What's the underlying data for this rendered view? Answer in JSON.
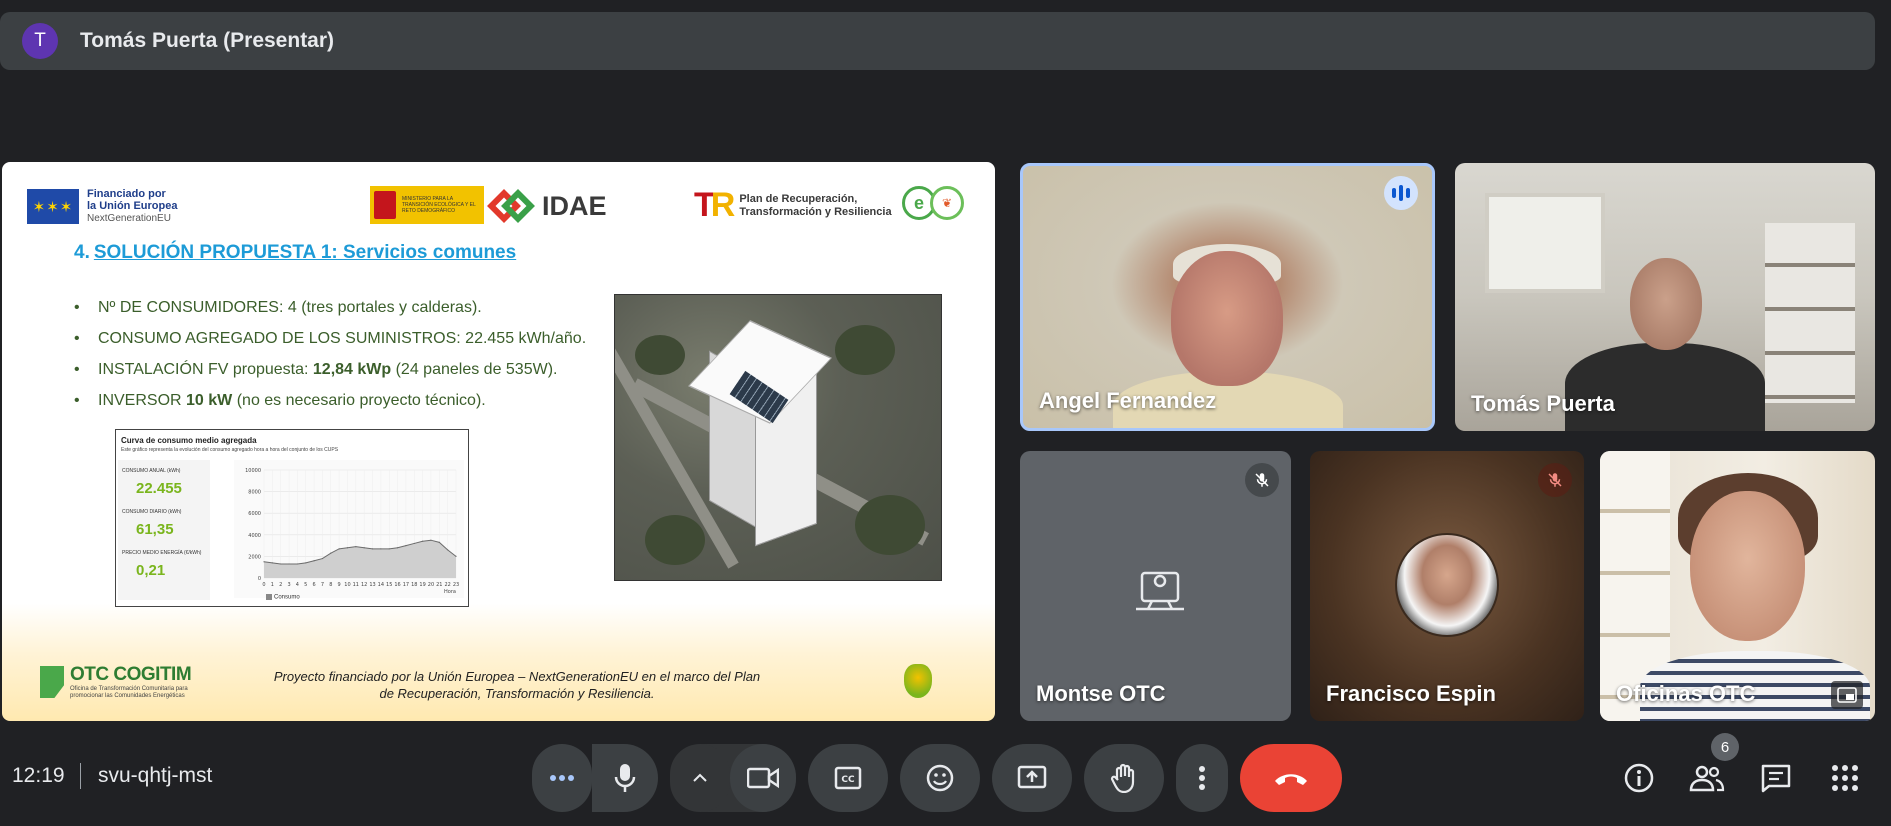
{
  "presenter_bar": {
    "avatar_letter": "T",
    "title": "Tomás Puerta (Presentar)"
  },
  "slide": {
    "logos": {
      "eu_line1": "Financiado por",
      "eu_line2": "la Unión Europea",
      "eu_line3": "NextGenerationEU",
      "ministerio_text": "MINISTERIO PARA LA TRANSICIÓN ECOLÓGICA Y EL RETO DEMOGRÁFICO",
      "idae": "IDAE",
      "plan_line1": "Plan de Recuperación,",
      "plan_line2": "Transformación y Resiliencia",
      "eco_mark": "e"
    },
    "title_number": "4.",
    "title_text": "SOLUCIÓN PROPUESTA 1: Servicios comunes",
    "bullets": [
      {
        "text": "Nº DE CONSUMIDORES: 4 (tres portales y calderas).",
        "bold": "",
        "rest": ""
      },
      {
        "text": "CONSUMO AGREGADO DE LOS SUMINISTROS: 22.455 kWh/año.",
        "bold": "",
        "rest": ""
      },
      {
        "text": "INSTALACIÓN FV propuesta: ",
        "bold": "12,84 kWp",
        "rest": " (24 paneles de 535W)."
      },
      {
        "text": "INVERSOR ",
        "bold": "10 kW",
        "rest": " (no es necesario proyecto técnico)."
      }
    ],
    "chart": {
      "title": "Curva de consumo medio agregada",
      "description": "Este gráfico representa la evolución del consumo agregado hora a hora del conjunto de los CUPS",
      "kpis": [
        {
          "label": "CONSUMO ANUAL (kWh)",
          "value": "22.455"
        },
        {
          "label": "CONSUMO DIARIO (kWh)",
          "value": "61,35"
        },
        {
          "label": "PRECIO MEDIO ENERGÍA (€/kWh)",
          "value": "0,21"
        }
      ],
      "legend": "Consumo",
      "x_label": "Hora"
    },
    "footer": {
      "org_name": "OTC COGITIM",
      "org_sub": "Oficina de Transformación Comunitaria para promocionar las Comunidades Energéticas",
      "text_line1": "Proyecto financiado por la Unión Europea – NextGenerationEU en el marco del Plan",
      "text_line2": "de Recuperación, Transformación y Resiliencia."
    }
  },
  "chart_data": {
    "type": "area",
    "title": "Curva de consumo medio agregada",
    "xlabel": "Hora",
    "ylabel": "",
    "x": [
      0,
      1,
      2,
      3,
      4,
      5,
      6,
      7,
      8,
      9,
      10,
      11,
      12,
      13,
      14,
      15,
      16,
      17,
      18,
      19,
      20,
      21,
      22,
      23
    ],
    "series": [
      {
        "name": "Consumo",
        "values": [
          1500,
          1400,
          1300,
          1300,
          1300,
          1400,
          1600,
          1800,
          2300,
          2700,
          2800,
          2900,
          2800,
          2700,
          2700,
          2700,
          2800,
          3000,
          3200,
          3400,
          3500,
          3300,
          2600,
          2000
        ]
      }
    ],
    "ylim": [
      0,
      10000
    ],
    "yticks": [
      0,
      2000,
      4000,
      6000,
      8000,
      10000
    ]
  },
  "participants": [
    {
      "name": "Angel Fernandez",
      "speaking": true,
      "muted": false
    },
    {
      "name": "Tomás Puerta",
      "speaking": false,
      "muted": false
    },
    {
      "name": "Montse OTC",
      "speaking": false,
      "muted": true,
      "camera_off": true
    },
    {
      "name": "Francisco Espin",
      "speaking": false,
      "muted": true
    },
    {
      "name": "Oficinas OTC",
      "speaking": false,
      "muted": false
    }
  ],
  "meeting": {
    "time": "12:19",
    "code": "svu-qhtj-mst",
    "people_count": "6"
  },
  "colors": {
    "background": "#202124",
    "control": "#3c4043",
    "leave": "#ea4335",
    "active_speaker_border": "#a8c7fa"
  }
}
